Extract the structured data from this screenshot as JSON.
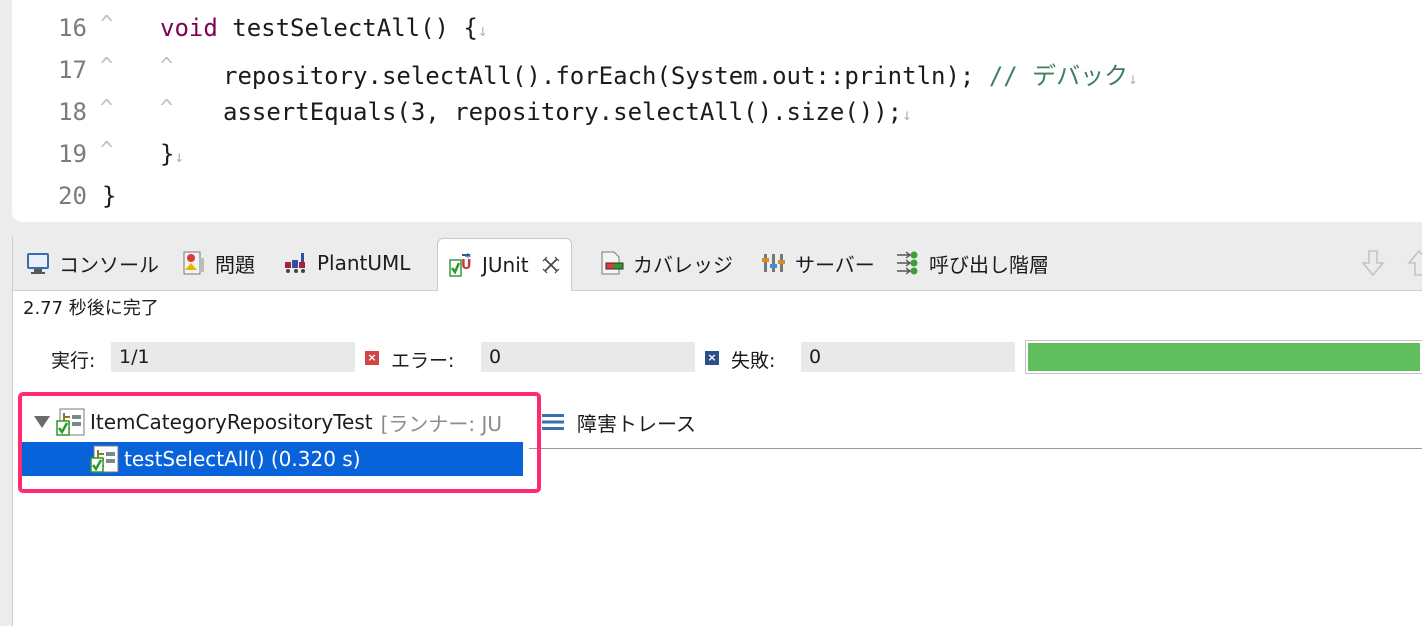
{
  "editor": {
    "lines": [
      {
        "num": "16",
        "ws": [
          "^"
        ],
        "indent": 2,
        "parts": [
          {
            "t": "void",
            "c": "kw"
          },
          {
            "t": " testSelectAll() {"
          }
        ],
        "eol": "↓"
      },
      {
        "num": "17",
        "ws": [
          "^",
          "^"
        ],
        "indent": 3,
        "parts": [
          {
            "t": "repository.selectAll().forEach(System.out::println); "
          },
          {
            "t": "// デバック",
            "c": "cm"
          }
        ],
        "eol": "↓"
      },
      {
        "num": "18",
        "ws": [
          "^",
          "^"
        ],
        "indent": 3,
        "parts": [
          {
            "t": "assertEquals(3, repository.selectAll().size());"
          }
        ],
        "eol": "↓"
      },
      {
        "num": "19",
        "ws": [
          "^"
        ],
        "indent": 2,
        "parts": [
          {
            "t": "}"
          }
        ],
        "eol": "↓"
      },
      {
        "num": "20",
        "ws": [],
        "indent": 1,
        "parts": [
          {
            "t": "}"
          }
        ],
        "eol": ""
      }
    ]
  },
  "tabs": {
    "console": "コンソール",
    "problems": "問題",
    "plantuml": "PlantUML",
    "junit": "JUnit",
    "coverage": "カバレッジ",
    "servers": "サーバー",
    "call_hierarchy": "呼び出し階層"
  },
  "junit": {
    "status": "2.77 秒後に完了",
    "runs_label": "実行:",
    "runs_value": "1/1",
    "errors_label": "エラー:",
    "errors_value": "0",
    "failures_label": "失敗:",
    "failures_value": "0",
    "progress_fraction": 1.0,
    "progress_color": "#5fbf5f",
    "tree": {
      "suite": "ItemCategoryRepositoryTest",
      "suite_runner": "[ランナー: JU",
      "test": "testSelectAll() (0.320 s)"
    },
    "trace_label": "障害トレース"
  },
  "colors": {
    "selection": "#0862d9",
    "highlight_box": "#ff2d6f",
    "keyword": "#7f0055",
    "comment": "#3f7f5f"
  }
}
